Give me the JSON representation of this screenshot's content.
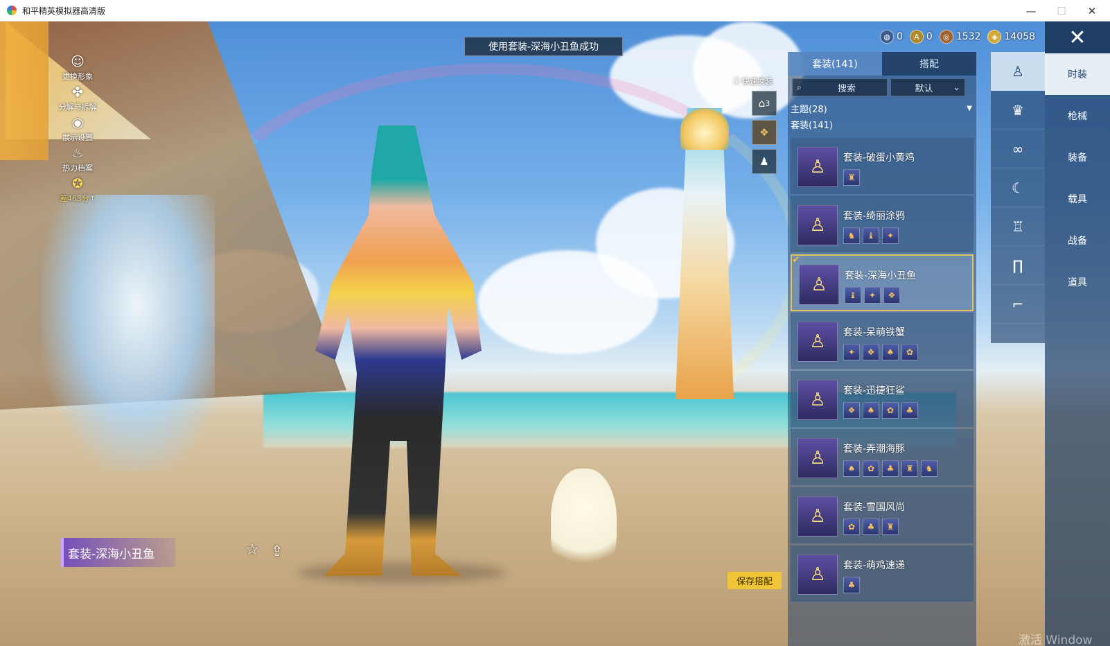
{
  "window": {
    "title": "和平精英模拟器高清版",
    "minimize": "—",
    "maximize": "☐",
    "close": "✕"
  },
  "left_menu": [
    {
      "label": "更换形象",
      "icon": "person-icon"
    },
    {
      "label": "分解与拆解",
      "icon": "gear-cross-icon"
    },
    {
      "label": "展示设置",
      "icon": "eye-icon"
    },
    {
      "label": "热力档案",
      "icon": "fire-icon"
    },
    {
      "label": "差463分↑",
      "icon": "rank-badge-icon"
    }
  ],
  "toast": "使用套装-深海小丑鱼成功",
  "currencies": [
    {
      "icon": "globe-coin-icon",
      "value": "0",
      "color": "#3d5a8a"
    },
    {
      "icon": "gold-a-coin-icon",
      "value": "0",
      "color": "#b08a2a"
    },
    {
      "icon": "bronze-coin-icon",
      "value": "1532",
      "color": "#a0622a"
    },
    {
      "icon": "gold-coin-icon",
      "value": "14058",
      "color": "#d4a93a"
    }
  ],
  "quick_change": {
    "label": "快速换装",
    "slot_number": "3"
  },
  "panel": {
    "tabs": [
      "套装(141)",
      "搭配"
    ],
    "active_tab": 0,
    "search_placeholder": "搜索",
    "sort_value": "默认",
    "theme_row": "主题(28)",
    "outfit_row": "套装(141)",
    "items": [
      {
        "name": "套装-破蛋小黄鸡",
        "sub_count": 1,
        "selected": false
      },
      {
        "name": "套装-绮丽涂鸦",
        "sub_count": 3,
        "selected": false
      },
      {
        "name": "套装-深海小丑鱼",
        "sub_count": 3,
        "selected": true
      },
      {
        "name": "套装-呆萌铁蟹",
        "sub_count": 4,
        "selected": false
      },
      {
        "name": "套装-迅捷狂鲨",
        "sub_count": 4,
        "selected": false
      },
      {
        "name": "套装-弄潮海豚",
        "sub_count": 5,
        "selected": false
      },
      {
        "name": "套装-雪国风尚",
        "sub_count": 3,
        "selected": false
      },
      {
        "name": "套装-萌鸡速递",
        "sub_count": 1,
        "selected": false
      }
    ]
  },
  "category_icons": [
    {
      "icon": "outfit-icon",
      "active": true
    },
    {
      "icon": "hat-icon",
      "active": false
    },
    {
      "icon": "glasses-icon",
      "active": false
    },
    {
      "icon": "mask-icon",
      "active": false
    },
    {
      "icon": "jacket-icon",
      "active": false
    },
    {
      "icon": "pants-icon",
      "active": false
    },
    {
      "icon": "shoes-icon",
      "active": false
    }
  ],
  "right_tabs": [
    {
      "label": "时装",
      "active": true
    },
    {
      "label": "枪械",
      "active": false
    },
    {
      "label": "装备",
      "active": false
    },
    {
      "label": "载具",
      "active": false
    },
    {
      "label": "战备",
      "active": false
    },
    {
      "label": "道具",
      "active": false
    }
  ],
  "outfit_title": "套装-深海小丑鱼",
  "save_button": "保存搭配",
  "watermark": "激活 Window"
}
